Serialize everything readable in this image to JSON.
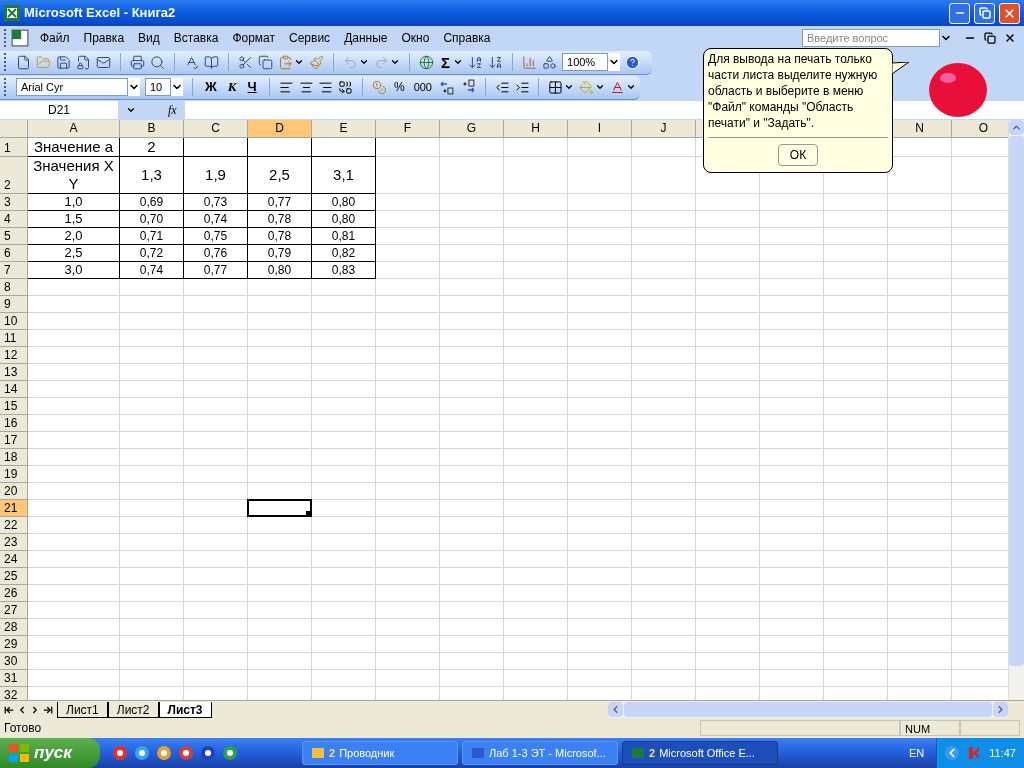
{
  "window": {
    "title": "Microsoft Excel - Книга2"
  },
  "menu": [
    "Файл",
    "Правка",
    "Вид",
    "Вставка",
    "Формат",
    "Сервис",
    "Данные",
    "Окно",
    "Справка"
  ],
  "help_search": {
    "placeholder": "Введите вопрос"
  },
  "standard_toolbar": {
    "autosum": "Σ",
    "zoom": "100%"
  },
  "formatting_toolbar": {
    "font": "Arial Cyr",
    "size": "10",
    "bold": "Ж",
    "italic": "К",
    "underline": "Ч",
    "percent": "%",
    "thousands": "000"
  },
  "formula_bar": {
    "name_box": "D21",
    "fx": "fx"
  },
  "sheet": {
    "columns": [
      {
        "label": "A",
        "selected": false
      },
      {
        "label": "B",
        "selected": false
      },
      {
        "label": "C",
        "selected": false
      },
      {
        "label": "D",
        "selected": true
      },
      {
        "label": "E",
        "selected": false
      },
      {
        "label": "F",
        "selected": false
      },
      {
        "label": "G",
        "selected": false
      },
      {
        "label": "H",
        "selected": false
      },
      {
        "label": "I",
        "selected": false
      },
      {
        "label": "J",
        "selected": false
      }
    ],
    "columns_after_balloon": [
      {
        "label": "N",
        "selected": false
      },
      {
        "label": "O",
        "selected": false
      }
    ],
    "rows": [
      {
        "label": "1",
        "selected": false,
        "kind": "title",
        "cells": [
          {
            "text": "Значение а"
          },
          {
            "text": "2"
          },
          {},
          {},
          {}
        ]
      },
      {
        "label": "2",
        "selected": false,
        "kind": "title",
        "cells": [
          {
            "text": "Значения X Y"
          },
          {
            "text": "1,3"
          },
          {
            "text": "1,9"
          },
          {
            "text": "2,5"
          },
          {
            "text": "3,1"
          }
        ]
      },
      {
        "label": "3",
        "selected": false,
        "kind": "value",
        "cells": [
          {
            "text": "1,0"
          },
          {
            "text": "0,69"
          },
          {
            "text": "0,73"
          },
          {
            "text": "0,77"
          },
          {
            "text": "0,80"
          }
        ]
      },
      {
        "label": "4",
        "selected": false,
        "kind": "value",
        "cells": [
          {
            "text": "1,5"
          },
          {
            "text": "0,70"
          },
          {
            "text": "0,74"
          },
          {
            "text": "0,78"
          },
          {
            "text": "0,80"
          }
        ]
      },
      {
        "label": "5",
        "selected": false,
        "kind": "value",
        "cells": [
          {
            "text": "2,0"
          },
          {
            "text": "0,71"
          },
          {
            "text": "0,75"
          },
          {
            "text": "0,78"
          },
          {
            "text": "0,81"
          }
        ]
      },
      {
        "label": "6",
        "selected": false,
        "kind": "value",
        "cells": [
          {
            "text": "2,5"
          },
          {
            "text": "0,72"
          },
          {
            "text": "0,76"
          },
          {
            "text": "0,79"
          },
          {
            "text": "0,82"
          }
        ]
      },
      {
        "label": "7",
        "selected": false,
        "kind": "value",
        "cells": [
          {
            "text": "3,0"
          },
          {
            "text": "0,74"
          },
          {
            "text": "0,77"
          },
          {
            "text": "0,80"
          },
          {
            "text": "0,83"
          }
        ]
      },
      {
        "label": "8",
        "selected": false
      },
      {
        "label": "9",
        "selected": false
      },
      {
        "label": "10",
        "selected": false
      },
      {
        "label": "11",
        "selected": false
      },
      {
        "label": "12",
        "selected": false
      },
      {
        "label": "13",
        "selected": false
      },
      {
        "label": "14",
        "selected": false
      },
      {
        "label": "15",
        "selected": false
      },
      {
        "label": "16",
        "selected": false
      },
      {
        "label": "17",
        "selected": false
      },
      {
        "label": "18",
        "selected": false
      },
      {
        "label": "19",
        "selected": false
      },
      {
        "label": "20",
        "selected": false
      },
      {
        "label": "21",
        "selected": true
      },
      {
        "label": "22",
        "selected": false
      },
      {
        "label": "23",
        "selected": false
      },
      {
        "label": "24",
        "selected": false
      },
      {
        "label": "25",
        "selected": false
      },
      {
        "label": "26",
        "selected": false
      },
      {
        "label": "27",
        "selected": false
      },
      {
        "label": "28",
        "selected": false
      },
      {
        "label": "29",
        "selected": false
      },
      {
        "label": "30",
        "selected": false
      },
      {
        "label": "31",
        "selected": false
      },
      {
        "label": "32",
        "selected": false
      }
    ]
  },
  "sheet_tabs": [
    {
      "label": "Лист1",
      "selected": false
    },
    {
      "label": "Лист2",
      "selected": false
    },
    {
      "label": "Лист3",
      "selected": true
    }
  ],
  "status_bar": {
    "text": "Готово",
    "indicator": "NUM"
  },
  "assistant_balloon": {
    "text": "Для вывода на печать только части листа выделите нужную область и выберите в меню \"Файл\" команды \"Область печати\" и \"Задать\".",
    "button": "ОК"
  },
  "taskbar": {
    "start": "пуск",
    "tasks": [
      {
        "count": "2",
        "label": "Проводник",
        "selected": false
      },
      {
        "label": "Лаб 1-3 ЭТ - Microsof...",
        "selected": false
      },
      {
        "count": "2",
        "label": "Microsoft Office E...",
        "selected": true
      }
    ],
    "language": "EN",
    "clock": "11:47"
  }
}
